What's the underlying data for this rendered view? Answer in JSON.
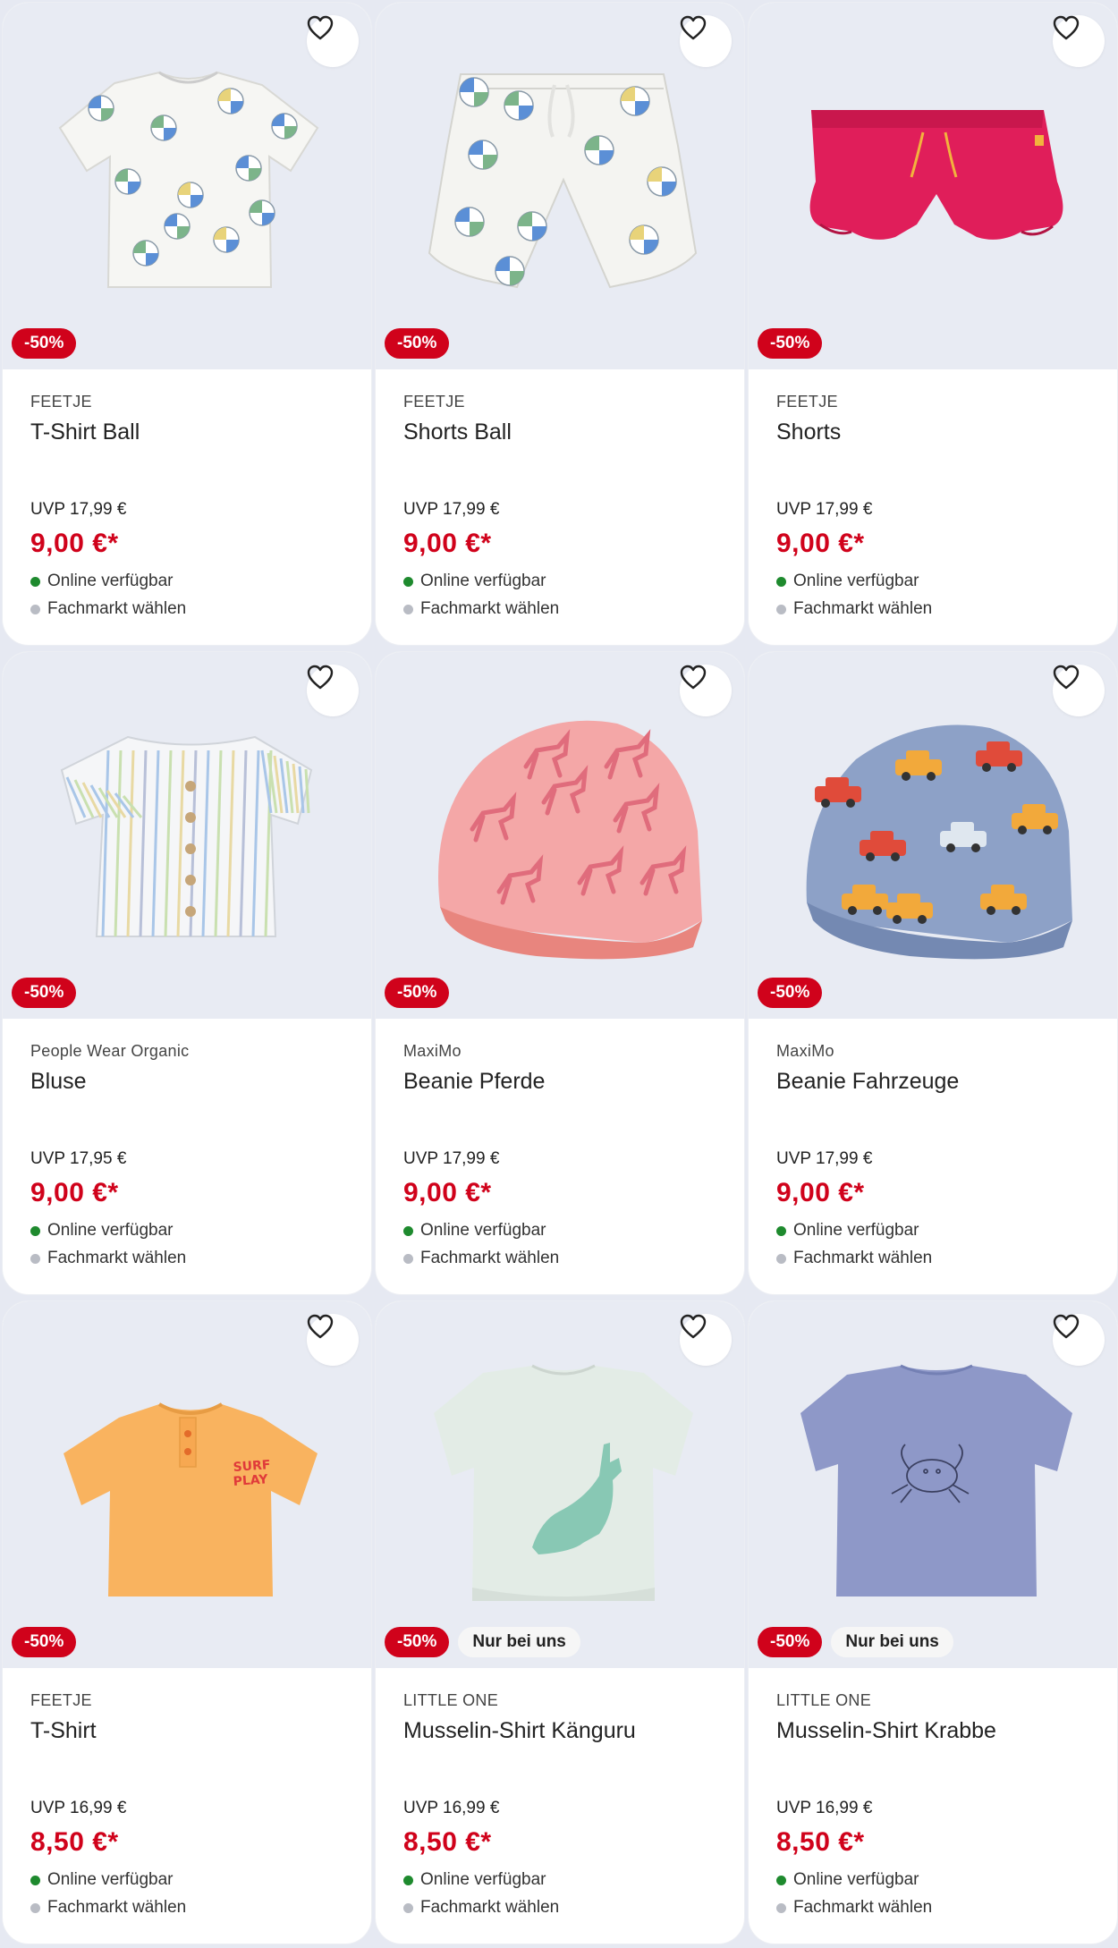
{
  "colors": {
    "sale": "#d0021b",
    "available": "#1e8a2e",
    "store_dot": "#b9bcc4",
    "image_bg": "#e8ebf3"
  },
  "icons": {
    "favorite": "heart-outline-icon"
  },
  "products": [
    {
      "image": "tshirt-ball",
      "discount": "-50%",
      "exclusive": "",
      "brand": "FEETJE",
      "name": "T-Shirt Ball",
      "uvp": "UVP 17,99 €",
      "price": "9,00 €*",
      "availability": "Online verfügbar",
      "store": "Fachmarkt wählen"
    },
    {
      "image": "shorts-ball",
      "discount": "-50%",
      "exclusive": "",
      "brand": "FEETJE",
      "name": "Shorts Ball",
      "uvp": "UVP 17,99 €",
      "price": "9,00 €*",
      "availability": "Online verfügbar",
      "store": "Fachmarkt wählen"
    },
    {
      "image": "shorts-pink",
      "discount": "-50%",
      "exclusive": "",
      "brand": "FEETJE",
      "name": "Shorts",
      "uvp": "UVP 17,99 €",
      "price": "9,00 €*",
      "availability": "Online verfügbar",
      "store": "Fachmarkt wählen"
    },
    {
      "image": "blouse",
      "discount": "-50%",
      "exclusive": "",
      "brand": "People Wear Organic",
      "name": "Bluse",
      "uvp": "UVP 17,95 €",
      "price": "9,00 €*",
      "availability": "Online verfügbar",
      "store": "Fachmarkt wählen"
    },
    {
      "image": "beanie-horses",
      "discount": "-50%",
      "exclusive": "",
      "brand": "MaxiMo",
      "name": "Beanie Pferde",
      "uvp": "UVP 17,99 €",
      "price": "9,00 €*",
      "availability": "Online verfügbar",
      "store": "Fachmarkt wählen"
    },
    {
      "image": "beanie-cars",
      "discount": "-50%",
      "exclusive": "",
      "brand": "MaxiMo",
      "name": "Beanie Fahrzeuge",
      "uvp": "UVP 17,99 €",
      "price": "9,00 €*",
      "availability": "Online verfügbar",
      "store": "Fachmarkt wählen"
    },
    {
      "image": "tshirt-orange",
      "discount": "-50%",
      "exclusive": "",
      "brand": "FEETJE",
      "name": "T-Shirt",
      "uvp": "UVP 16,99 €",
      "price": "8,50 €*",
      "availability": "Online verfügbar",
      "store": "Fachmarkt wählen"
    },
    {
      "image": "shirt-kangaroo",
      "discount": "-50%",
      "exclusive": "Nur bei uns",
      "brand": "LITTLE ONE",
      "name": "Musselin-Shirt Känguru",
      "uvp": "UVP 16,99 €",
      "price": "8,50 €*",
      "availability": "Online verfügbar",
      "store": "Fachmarkt wählen"
    },
    {
      "image": "shirt-crab",
      "discount": "-50%",
      "exclusive": "Nur bei uns",
      "brand": "LITTLE ONE",
      "name": "Musselin-Shirt Krabbe",
      "uvp": "UVP 16,99 €",
      "price": "8,50 €*",
      "availability": "Online verfügbar",
      "store": "Fachmarkt wählen"
    }
  ]
}
